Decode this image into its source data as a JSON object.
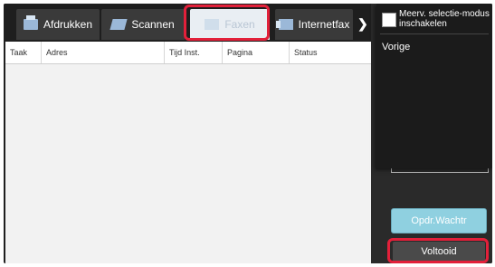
{
  "tabs": [
    {
      "label": "Afdrukken",
      "icon": "printer-icon"
    },
    {
      "label": "Scannen",
      "icon": "scanner-icon"
    },
    {
      "label": "Faxen",
      "icon": "fax-icon",
      "state": "selected-disabled"
    },
    {
      "label": "Internetfax",
      "icon": "internet-fax-icon"
    }
  ],
  "more_tabs_icon": "chevron-right-icon",
  "table": {
    "columns": [
      "Taak",
      "Adres",
      "Tijd Inst.",
      "Pagina",
      "Status"
    ],
    "rows": []
  },
  "menu": {
    "multi_select_label": "Meerv. selectie-modus inschakelen",
    "multi_select_checked": false,
    "previous_label": "Vorige"
  },
  "buttons": {
    "job_queue_label": "Opdr.Wachtr",
    "completed_label": "Voltooid"
  },
  "colors": {
    "highlight": "#e2203a",
    "job_queue_button": "#8fd0e0"
  }
}
